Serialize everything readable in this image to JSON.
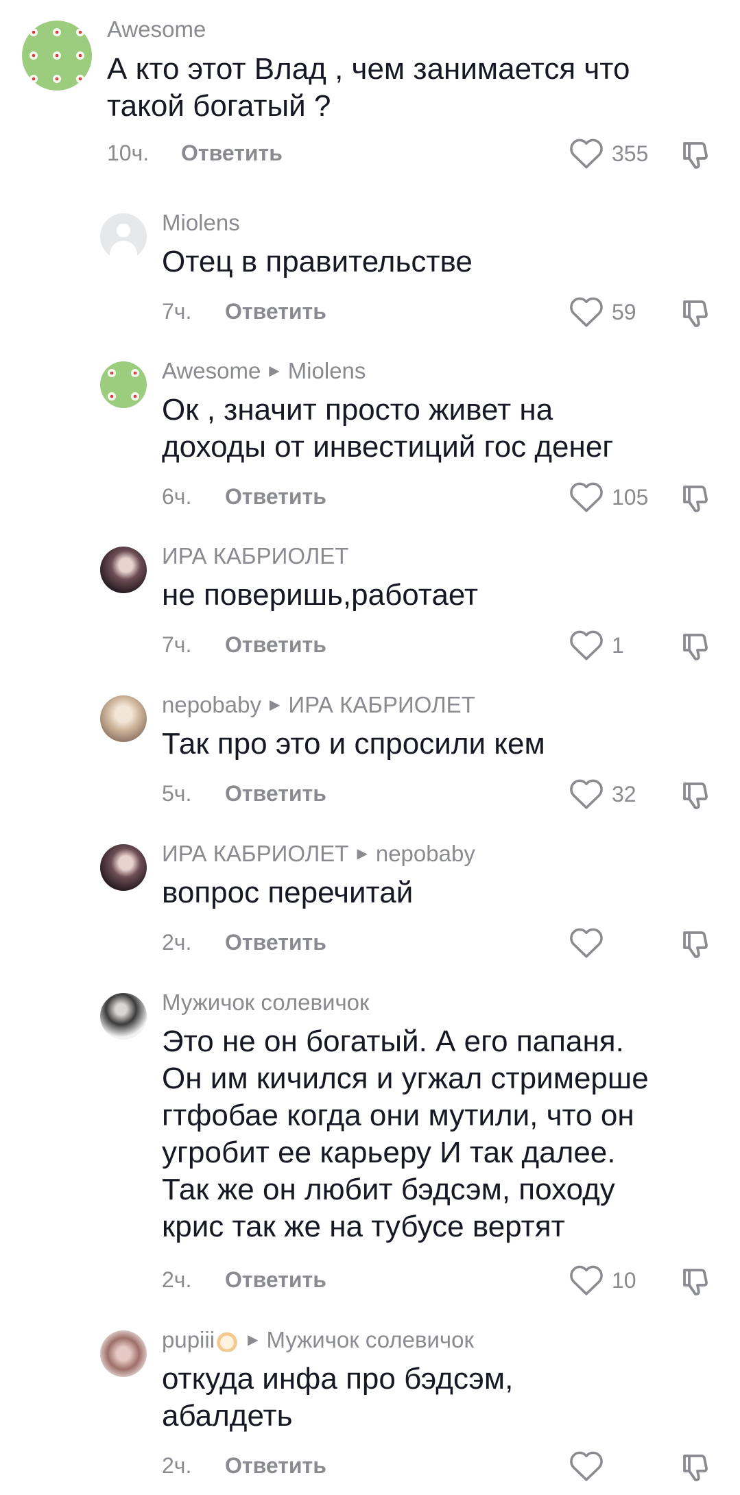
{
  "reply_label": "Ответить",
  "comments": [
    {
      "user": "Awesome",
      "reply_to": "",
      "text": "А кто этот Влад , чем занимается что\nтакой богатый ?",
      "time": "10ч.",
      "likes": "355"
    },
    {
      "user": "Miolens",
      "reply_to": "",
      "text": "Отец в правительстве",
      "time": "7ч.",
      "likes": "59"
    },
    {
      "user": "Awesome",
      "reply_to": "Miolens",
      "text": "Ок , значит просто живет на\nдоходы от инвестиций гос денег",
      "time": "6ч.",
      "likes": "105"
    },
    {
      "user": "ИРА КАБРИОЛЕТ",
      "reply_to": "",
      "text": "не поверишь,работает",
      "time": "7ч.",
      "likes": "1"
    },
    {
      "user": "nepobaby",
      "reply_to": "ИРА КАБРИОЛЕТ",
      "text": "Так про это и спросили кем",
      "time": "5ч.",
      "likes": "32"
    },
    {
      "user": "ИРА КАБРИОЛЕТ",
      "reply_to": "nepobaby",
      "text": "вопрос перечитай",
      "time": "2ч.",
      "likes": ""
    },
    {
      "user": "Мужичок солевичок",
      "reply_to": "",
      "text": "Это не он богатый. А его папаня.\nОн им кичился и угжал стримерше\nгтфобае когда они мутили, что он\nугробит ее карьеру И так далее.\nТак же он любит бэдсэм, походу\nкрис так же на тубусе вертят",
      "time": "2ч.",
      "likes": "10"
    },
    {
      "user": "pupiii",
      "reply_to": "Мужичок солевичок",
      "text": "откуда инфа про бэдсэм,\nабалдеть",
      "time": "2ч.",
      "likes": ""
    }
  ]
}
